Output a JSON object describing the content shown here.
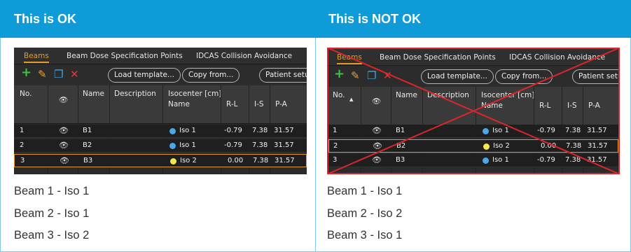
{
  "headers": {
    "left": "This is OK",
    "right": "This is NOT OK"
  },
  "tabs": [
    "Beams",
    "Beam Dose Specification Points",
    "IDCAS Collision Avoidance"
  ],
  "toolbar": {
    "load_template": "Load template...",
    "copy_from": "Copy from...",
    "patient_setup": "Patient setu"
  },
  "table": {
    "columns": {
      "no": "No.",
      "name": "Name",
      "description": "Description",
      "isocenter": "Isocenter [cm]",
      "iso_name": "Name",
      "rl": "R-L",
      "is": "I-S",
      "pa": "P-A"
    }
  },
  "ok_rows": [
    {
      "no": "1",
      "name": "B1",
      "iso": "Iso 1",
      "iso_color": "#4aa8e8",
      "rl": "-0.79",
      "is": "7.38",
      "pa": "31.57"
    },
    {
      "no": "2",
      "name": "B2",
      "iso": "Iso 1",
      "iso_color": "#4aa8e8",
      "rl": "-0.79",
      "is": "7.38",
      "pa": "31.57"
    },
    {
      "no": "3",
      "name": "B3",
      "iso": "Iso 2",
      "iso_color": "#f4e84a",
      "rl": "0.00",
      "is": "7.38",
      "pa": "31.57"
    }
  ],
  "notok_rows": [
    {
      "no": "1",
      "name": "B1",
      "iso": "Iso 1",
      "iso_color": "#4aa8e8",
      "rl": "-0.79",
      "is": "7.38",
      "pa": "31.57"
    },
    {
      "no": "2",
      "name": "B2",
      "iso": "Iso 2",
      "iso_color": "#f4e84a",
      "rl": "0.00",
      "is": "7.38",
      "pa": "31.57"
    },
    {
      "no": "3",
      "name": "B3",
      "iso": "Iso 1",
      "iso_color": "#4aa8e8",
      "rl": "-0.79",
      "is": "7.38",
      "pa": "31.57"
    }
  ],
  "captions": {
    "left": [
      "Beam 1 - Iso 1",
      "Beam 2 - Iso 1",
      "Beam 3 - Iso 2"
    ],
    "right": [
      "Beam 1 - Iso 1",
      "Beam 2 - Iso 2",
      "Beam 3 - Iso 1"
    ]
  },
  "colors": {
    "header_blue": "#0f9bd7",
    "accent_orange": "#e39a2a",
    "cross_red": "#d9262d"
  }
}
